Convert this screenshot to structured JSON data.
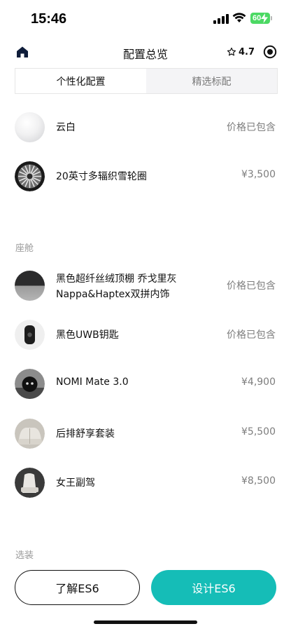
{
  "status_bar": {
    "time": "15:46",
    "battery": "60"
  },
  "nav": {
    "title": "配置总览",
    "rating": "4.7"
  },
  "tabs": [
    {
      "label": "个性化配置",
      "active": true
    },
    {
      "label": "精选标配",
      "active": false
    }
  ],
  "exterior": [
    {
      "name": "云白",
      "price": "价格已包含",
      "icon": "white-paint-swatch"
    },
    {
      "name": "20英寸多辐织雪轮圈",
      "price": "¥3,500",
      "icon": "wheel-rim"
    }
  ],
  "cabin": {
    "label": "座舱",
    "items": [
      {
        "name_line1": "黑色超纤丝绒顶棚 乔戈里灰",
        "name_line2": "Nappa&Haptex双拼内饰",
        "price": "价格已包含",
        "icon": "interior-swatch"
      },
      {
        "name": "黑色UWB钥匙",
        "price": "价格已包含",
        "icon": "uwb-key"
      },
      {
        "name": "NOMI Mate 3.0",
        "price": "¥4,900",
        "icon": "nomi-robot"
      },
      {
        "name": "后排舒享套装",
        "price": "¥5,500",
        "icon": "rear-seat"
      },
      {
        "name": "女王副驾",
        "price": "¥8,500",
        "icon": "queen-passenger-seat"
      }
    ]
  },
  "options": {
    "label": "选装"
  },
  "buttons": {
    "learn": "了解ES6",
    "design": "设计ES6"
  },
  "colors": {
    "accent": "#15bdb7",
    "battery": "#4cd964"
  }
}
